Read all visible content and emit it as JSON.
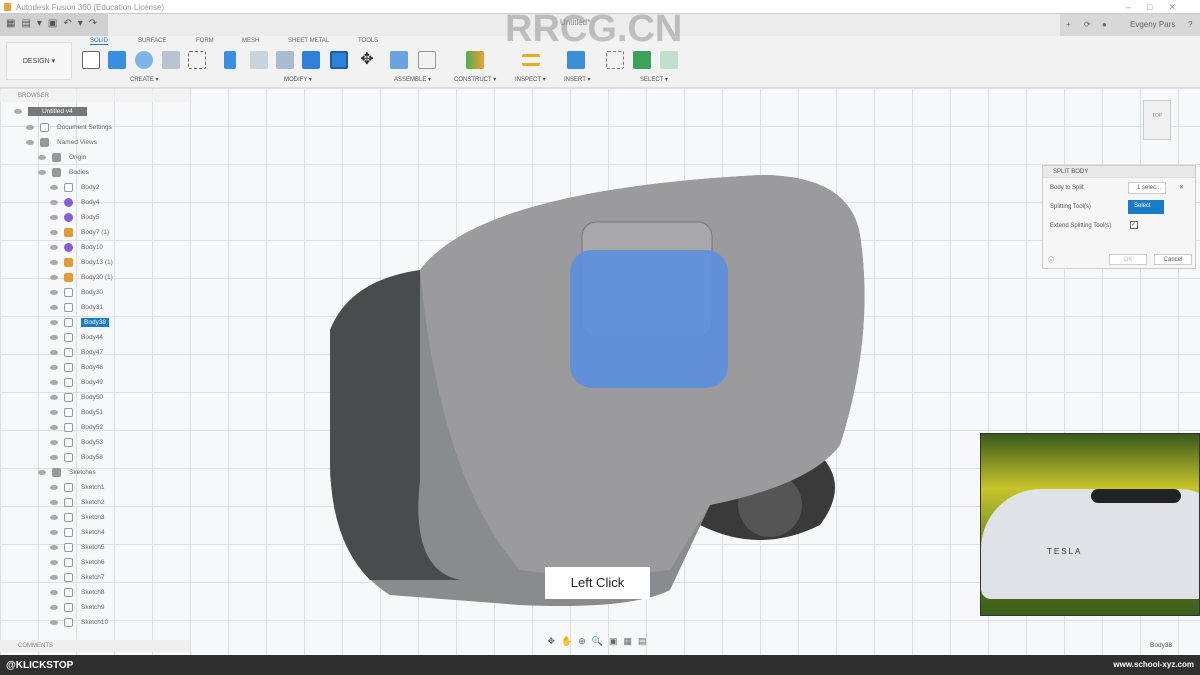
{
  "window": {
    "title": "Autodesk Fusion 360 (Education License)",
    "doc_tab": "Untitled*",
    "user": "Evgeny Pars"
  },
  "ribbon": {
    "workspace": "DESIGN ▾",
    "tabs": [
      "SOLID",
      "SURFACE",
      "FORM",
      "MESH",
      "SHEET METAL",
      "TOOLS"
    ],
    "groups": [
      "CREATE ▾",
      "MODIFY ▾",
      "ASSEMBLE ▾",
      "CONSTRUCT ▾",
      "INSPECT ▾",
      "INSERT ▾",
      "SELECT ▾"
    ]
  },
  "browser": {
    "header": "BROWSER",
    "root": "Untitled v4",
    "items": [
      {
        "label": "Document Settings",
        "type": "gear",
        "indent": 1
      },
      {
        "label": "Named Views",
        "type": "folder",
        "indent": 1
      },
      {
        "label": "Origin",
        "type": "folder",
        "indent": 2
      },
      {
        "label": "Bodies",
        "type": "folder",
        "indent": 2
      },
      {
        "label": "Body2",
        "type": "body",
        "indent": 3
      },
      {
        "label": "Body4",
        "type": "purple",
        "indent": 3
      },
      {
        "label": "Body5",
        "type": "purple",
        "indent": 3
      },
      {
        "label": "Body7 (1)",
        "type": "orange",
        "indent": 3
      },
      {
        "label": "Body10",
        "type": "purple",
        "indent": 3
      },
      {
        "label": "Body13 (1)",
        "type": "orange",
        "indent": 3
      },
      {
        "label": "Body20 (1)",
        "type": "orange",
        "indent": 3
      },
      {
        "label": "Body30",
        "type": "body",
        "indent": 3
      },
      {
        "label": "Body31",
        "type": "body",
        "indent": 3
      },
      {
        "label": "Body38",
        "type": "body",
        "indent": 3,
        "selected": true
      },
      {
        "label": "Body44",
        "type": "body",
        "indent": 3
      },
      {
        "label": "Body47",
        "type": "body",
        "indent": 3
      },
      {
        "label": "Body48",
        "type": "body",
        "indent": 3
      },
      {
        "label": "Body49",
        "type": "body",
        "indent": 3
      },
      {
        "label": "Body50",
        "type": "body",
        "indent": 3
      },
      {
        "label": "Body51",
        "type": "body",
        "indent": 3
      },
      {
        "label": "Body52",
        "type": "body",
        "indent": 3
      },
      {
        "label": "Body53",
        "type": "body",
        "indent": 3
      },
      {
        "label": "Body58",
        "type": "body",
        "indent": 3
      },
      {
        "label": "Sketches",
        "type": "folder",
        "indent": 2
      },
      {
        "label": "Sketch1",
        "type": "body",
        "indent": 3
      },
      {
        "label": "Sketch2",
        "type": "body",
        "indent": 3
      },
      {
        "label": "Sketch3",
        "type": "body",
        "indent": 3
      },
      {
        "label": "Sketch4",
        "type": "body",
        "indent": 3
      },
      {
        "label": "Sketch5",
        "type": "body",
        "indent": 3
      },
      {
        "label": "Sketch6",
        "type": "body",
        "indent": 3
      },
      {
        "label": "Sketch7",
        "type": "body",
        "indent": 3
      },
      {
        "label": "Sketch8",
        "type": "body",
        "indent": 3
      },
      {
        "label": "Sketch9",
        "type": "body",
        "indent": 3
      },
      {
        "label": "Sketch10",
        "type": "body",
        "indent": 3
      }
    ]
  },
  "comments": "COMMENTS",
  "dialog": {
    "title": "SPLIT BODY",
    "body_to_split": "Body to Split",
    "body_value": "1 selec...",
    "splitting_tool": "Splitting Tool(s)",
    "select": "Select",
    "extend": "Extend Splitting Tool(s)",
    "ok": "OK",
    "cancel": "Cancel"
  },
  "viewcube": "TOP",
  "tooltip": "Left Click",
  "inset_text": "TESLA",
  "status_body": "Body38",
  "footer": {
    "left": "@KLICKSTOP",
    "right": "www.school-xyz.com"
  },
  "watermark": "RRCG.CN"
}
